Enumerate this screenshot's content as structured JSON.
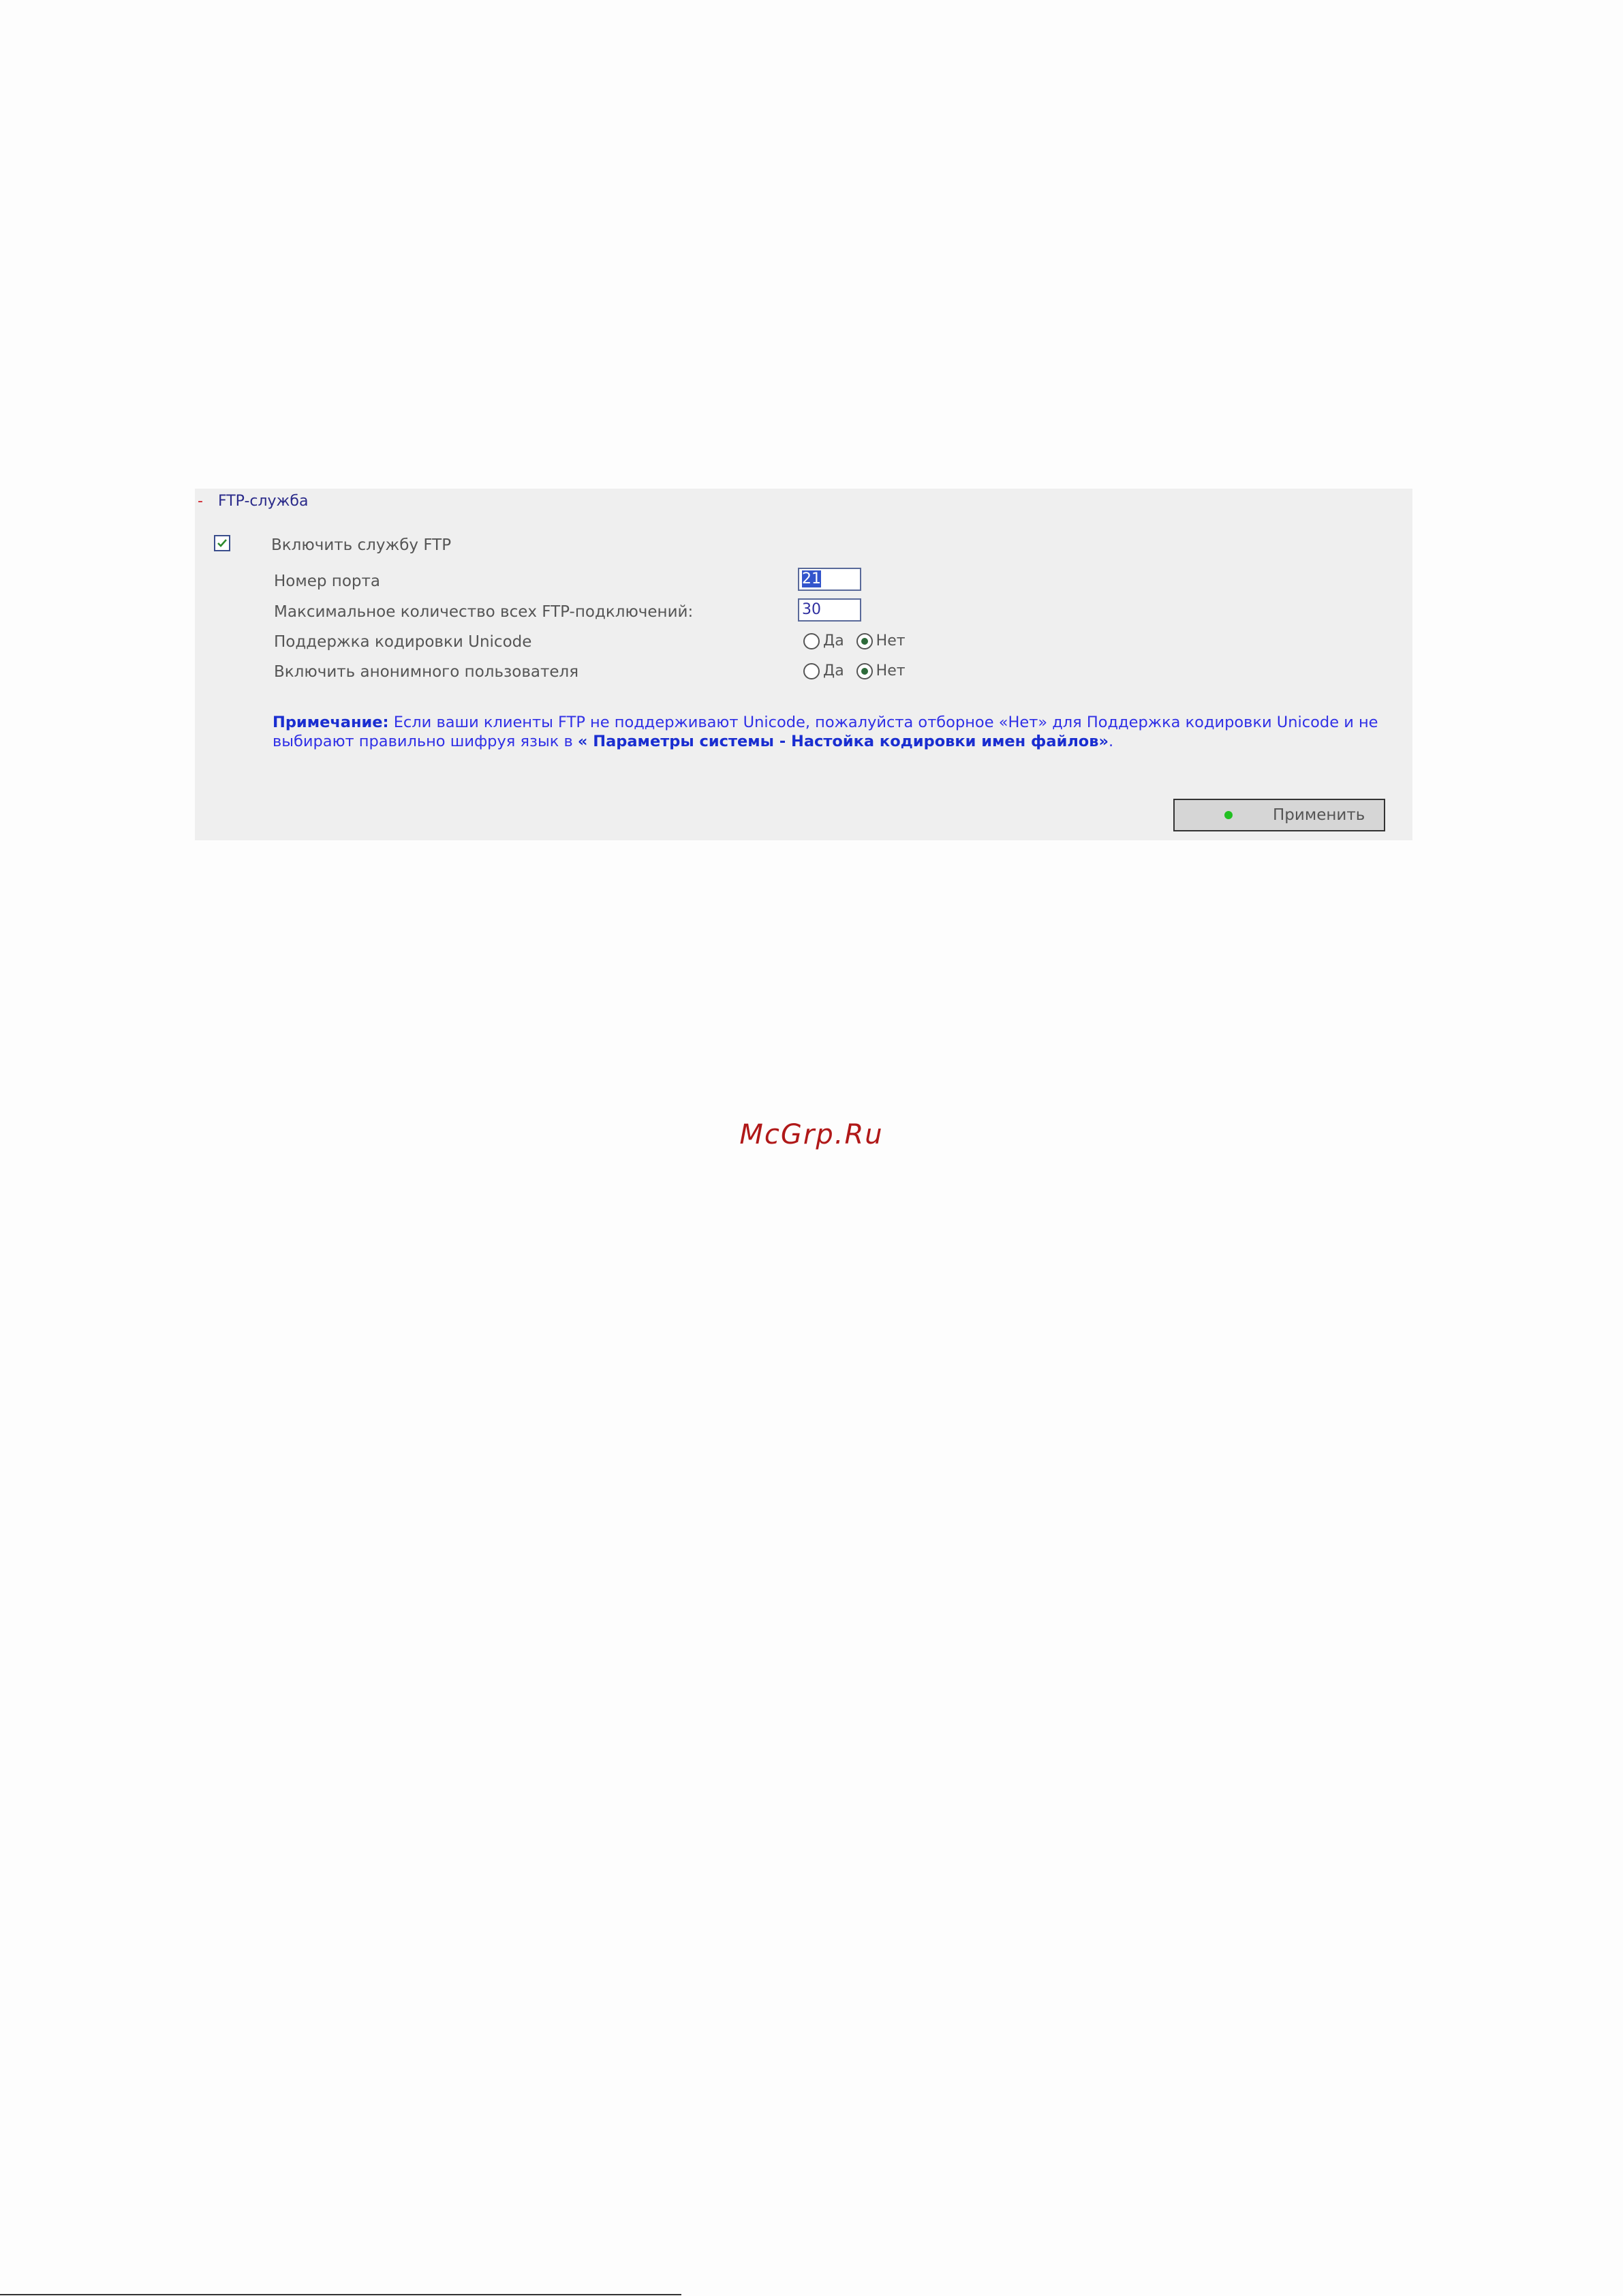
{
  "panel": {
    "toggle": "-",
    "title": "FTP-служба",
    "enable_label": "Включить службу FTP",
    "enable_checked": true,
    "port": {
      "label": "Номер порта",
      "value": "21"
    },
    "max_connections": {
      "label": "Максимальное количество всех FTP-подключений:",
      "value": "30"
    },
    "unicode": {
      "label": "Поддержка кодировки Unicode",
      "options": [
        "Да",
        "Нет"
      ],
      "selected": "Нет"
    },
    "anonymous": {
      "label": "Включить анонимного пользователя",
      "options": [
        "Да",
        "Нет"
      ],
      "selected": "Нет"
    },
    "note": {
      "label": "Примечание:",
      "text": " Если ваши клиенты FTP не поддерживают Unicode, пожалуйста отборное «Нет» для Поддержка кодировки Unicode и не выбирают правильно шифруя язык в ",
      "link": "« Параметры системы - Настойка кодировки имен файлов»",
      "end": "."
    },
    "apply_label": "Применить"
  },
  "watermark": "McGrp.Ru",
  "colors": {
    "panel_bg": "#efefef",
    "note": "#3030e6",
    "header": "#2a2a8a",
    "watermark": "#b01818",
    "status_dot": "#22c022"
  }
}
